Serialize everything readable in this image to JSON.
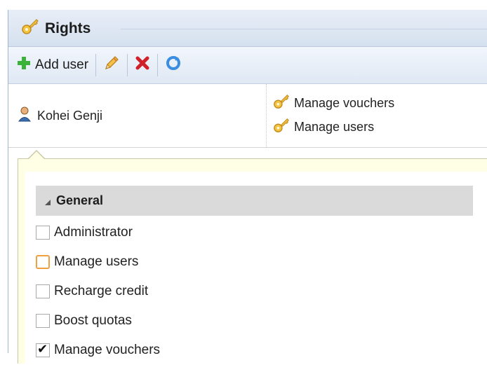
{
  "header": {
    "title": "Rights",
    "icon": "key-icon"
  },
  "toolbar": {
    "add_user_label": "Add user",
    "edit_icon": "pencil-icon",
    "delete_icon": "delete-icon",
    "refresh_icon": "refresh-icon"
  },
  "user_row": {
    "user_name": "Kohei Genji",
    "rights": [
      "Manage vouchers",
      "Manage users"
    ]
  },
  "popup": {
    "group_label": "General",
    "options": [
      {
        "label": "Administrator",
        "checked": false
      },
      {
        "label": "Manage users",
        "checked": false,
        "focused": true
      },
      {
        "label": "Recharge credit",
        "checked": false
      },
      {
        "label": "Boost quotas",
        "checked": false
      },
      {
        "label": "Manage vouchers",
        "checked": true
      }
    ]
  },
  "colors": {
    "header_bg": "#d5e0ef",
    "popup_bg": "#ffffe6",
    "group_header_bg": "#dadada",
    "focus_border": "#f0a040"
  }
}
